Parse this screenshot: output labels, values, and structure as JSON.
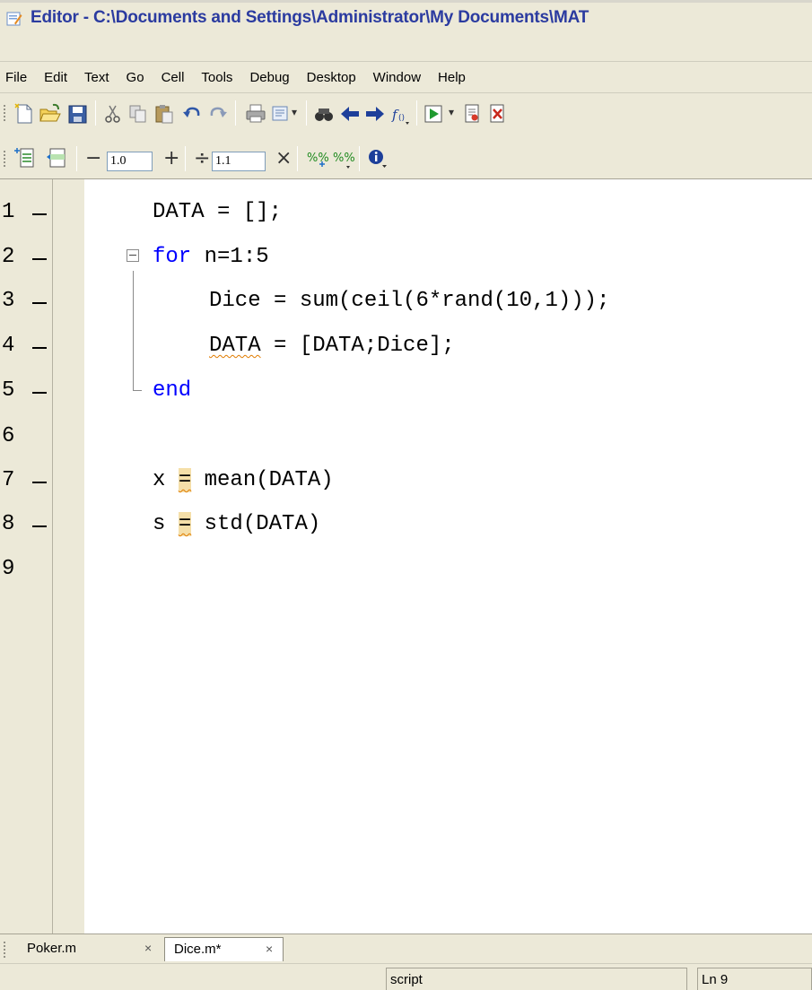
{
  "window": {
    "title": "Editor - C:\\Documents and Settings\\Administrator\\My Documents\\MAT"
  },
  "menu": [
    "File",
    "Edit",
    "Text",
    "Go",
    "Cell",
    "Tools",
    "Debug",
    "Desktop",
    "Window",
    "Help"
  ],
  "toolbar": {
    "icons": [
      "new-file-icon",
      "open-folder-icon",
      "save-icon",
      "cut-icon",
      "copy-icon",
      "paste-icon",
      "undo-icon",
      "redo-icon",
      "print-icon",
      "publish-icon",
      "find-icon",
      "back-icon",
      "forward-icon",
      "function-icon",
      "run-icon",
      "breakpoint-set-icon",
      "breakpoint-clear-icon"
    ]
  },
  "cell_toolbar": {
    "subtract_value": "1.0",
    "divide_value": "1.1",
    "minus_label": "−",
    "plus_label": "+",
    "divide_label": "÷",
    "times_label": "×"
  },
  "editor": {
    "lines": [
      {
        "number": "1",
        "breakpointable": true
      },
      {
        "number": "2",
        "breakpointable": true
      },
      {
        "number": "3",
        "breakpointable": true
      },
      {
        "number": "4",
        "breakpointable": true
      },
      {
        "number": "5",
        "breakpointable": true
      },
      {
        "number": "6",
        "breakpointable": false
      },
      {
        "number": "7",
        "breakpointable": true
      },
      {
        "number": "8",
        "breakpointable": true
      },
      {
        "number": "9",
        "breakpointable": false
      }
    ],
    "code": {
      "l1": "DATA = [];",
      "l2_kw": "for",
      "l2_rest": " n=1:5",
      "l3": "Dice = sum(ceil(6*rand(10,1)));",
      "l4_var": "DATA",
      "l4_rest": " = [DATA;Dice];",
      "l5_kw": "end",
      "l7_var": "x ",
      "l7_eq": "=",
      "l7_rest": " mean(DATA)",
      "l8_var": "s ",
      "l8_eq": "=",
      "l8_rest": " std(DATA)"
    },
    "keyword_color": "#0000ff",
    "warning_highlight": "#f5dfa9"
  },
  "tabs": [
    {
      "label": "Poker.m",
      "active": false
    },
    {
      "label": "Dice.m*",
      "active": true
    }
  ],
  "tab_close_glyph": "×",
  "status": {
    "mode": "script",
    "position": "Ln  9"
  }
}
